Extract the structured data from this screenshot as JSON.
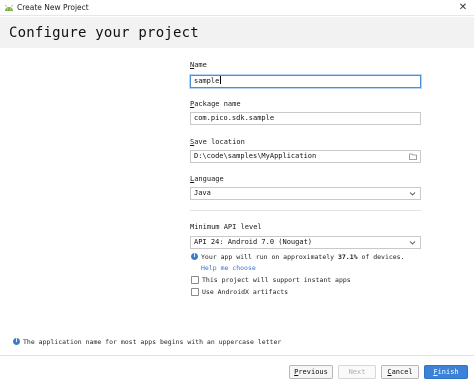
{
  "window": {
    "title": "Create New Project",
    "close_glyph": "✕"
  },
  "page": {
    "heading": "Configure your project"
  },
  "form": {
    "name": {
      "label": "Name",
      "value": "sample"
    },
    "package_name": {
      "label": "Package name",
      "value": "com.pico.sdk.sample"
    },
    "save_location": {
      "label": "Save location",
      "value": "D:\\code\\samples\\MyApplication"
    },
    "language": {
      "label": "Language",
      "value": "Java"
    },
    "minimum_api": {
      "label": "Minimum API level",
      "value": "API 24: Android 7.0 (Nougat)"
    },
    "api_note": {
      "prefix": "Your app will run on approximately ",
      "percent": "37.1%",
      "suffix": " of devices."
    },
    "help_link": "Help me choose",
    "instant_apps": {
      "label": "This project will support instant apps",
      "checked": false
    },
    "androidx": {
      "label": "Use AndroidX artifacts",
      "checked": false
    }
  },
  "hint": "The application name for most apps begins with an uppercase letter",
  "footer": {
    "previous": "Previous",
    "next": "Next",
    "cancel": "Cancel",
    "finish": "Finish"
  },
  "icons": {
    "app": "android-icon",
    "folder": "folder-icon",
    "info": "info-icon",
    "chevron": "chevron-down-icon"
  },
  "colors": {
    "accent": "#3b82d8",
    "link": "#3a74c4",
    "info": "#3d7cc9",
    "android": "#7cb342"
  }
}
